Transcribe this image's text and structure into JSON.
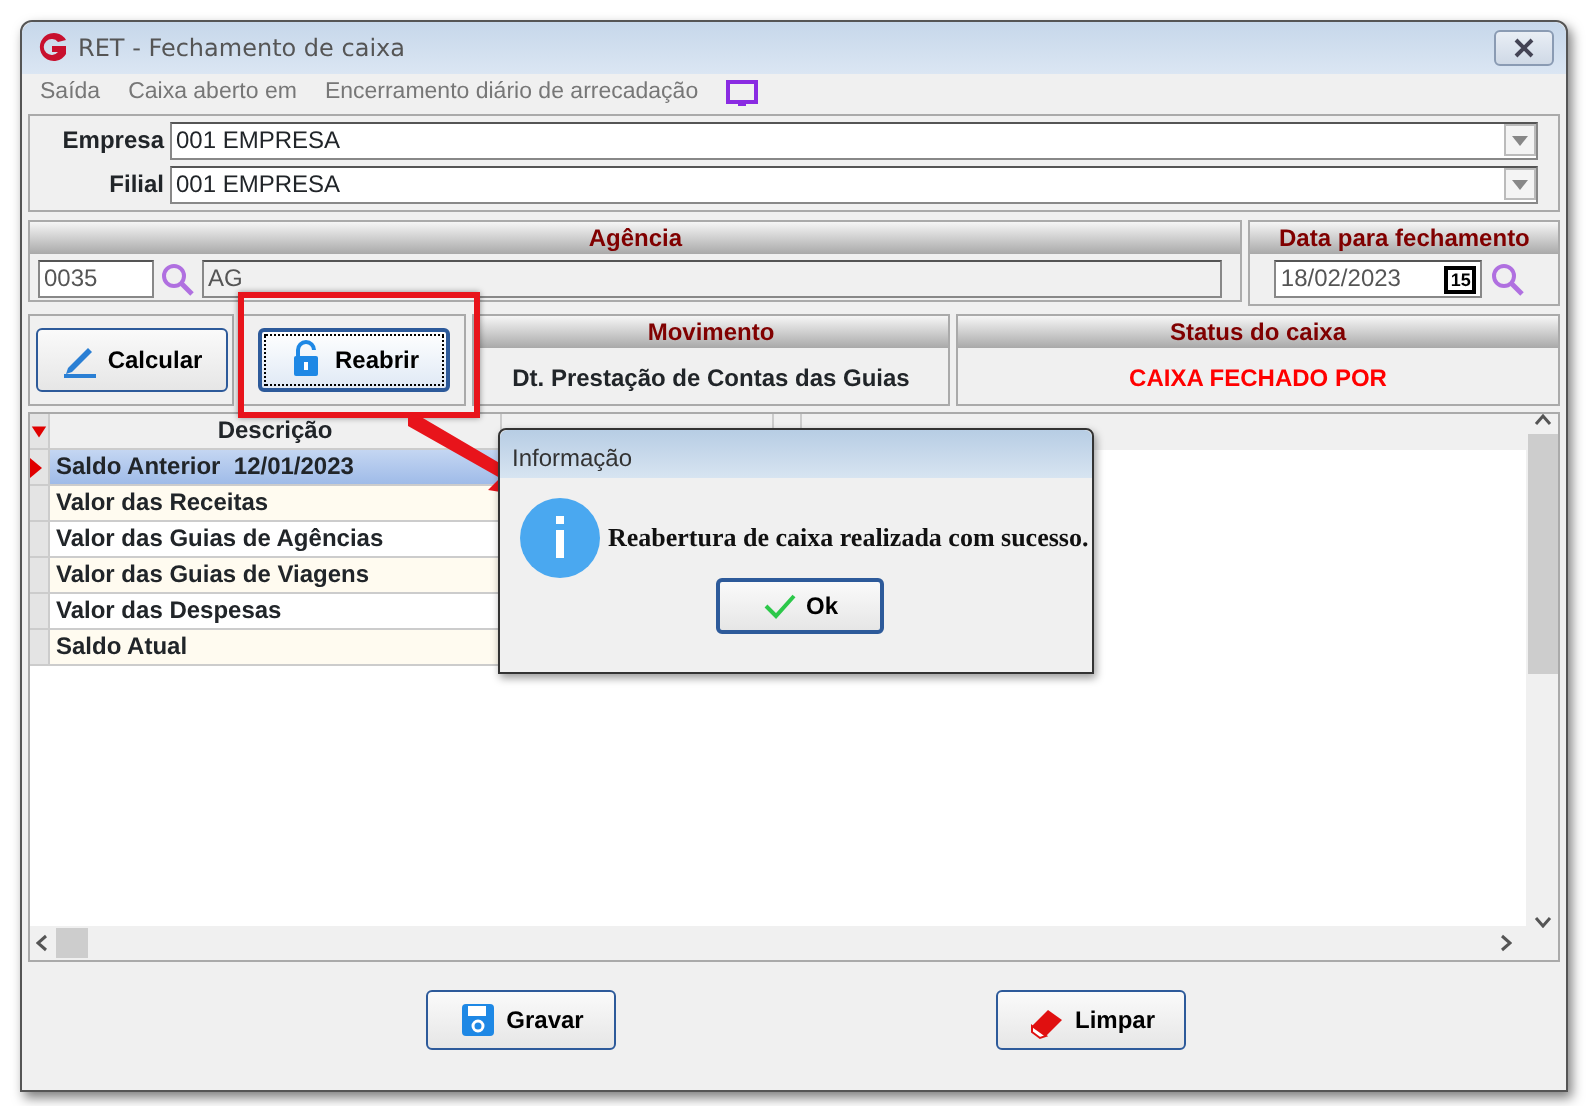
{
  "window": {
    "title": "RET - Fechamento de caixa"
  },
  "menu": [
    {
      "label": "Saída"
    },
    {
      "label": "Caixa aberto em"
    },
    {
      "label": "Encerramento diário de arrecadação"
    }
  ],
  "empresa": {
    "label": "Empresa",
    "value": "001 EMPRESA"
  },
  "filial": {
    "label": "Filial",
    "value": "001 EMPRESA"
  },
  "agencia": {
    "title": "Agência",
    "code": "0035",
    "name": "AG"
  },
  "data_fechamento": {
    "title": "Data para fechamento",
    "value": "18/02/2023",
    "calendar_day": "15"
  },
  "actions": [
    {
      "label": "Calcular",
      "focused": false
    },
    {
      "label": "Reabrir",
      "focused": true
    }
  ],
  "movimento": {
    "title": "Movimento",
    "text": "Dt. Prestação de Contas das Guias"
  },
  "status": {
    "title": "Status do caixa",
    "text": "CAIXA FECHADO POR"
  },
  "grid": {
    "columns": [
      "Descrição"
    ],
    "rows": [
      {
        "label": "Saldo Anterior  12/01/2023",
        "selected": true
      },
      {
        "label": "Valor das Receitas",
        "selected": false
      },
      {
        "label": "Valor das Guias de Agências",
        "selected": false
      },
      {
        "label": "Valor das Guias de Viagens",
        "selected": false
      },
      {
        "label": "Valor das Despesas",
        "selected": false
      },
      {
        "label": "Saldo Atual",
        "selected": false
      }
    ]
  },
  "footer_buttons": [
    {
      "label": "Gravar"
    },
    {
      "label": "Limpar"
    }
  ],
  "dialog": {
    "title": "Informação",
    "message": "Reabertura de caixa realizada com sucesso.",
    "button": "Ok"
  }
}
